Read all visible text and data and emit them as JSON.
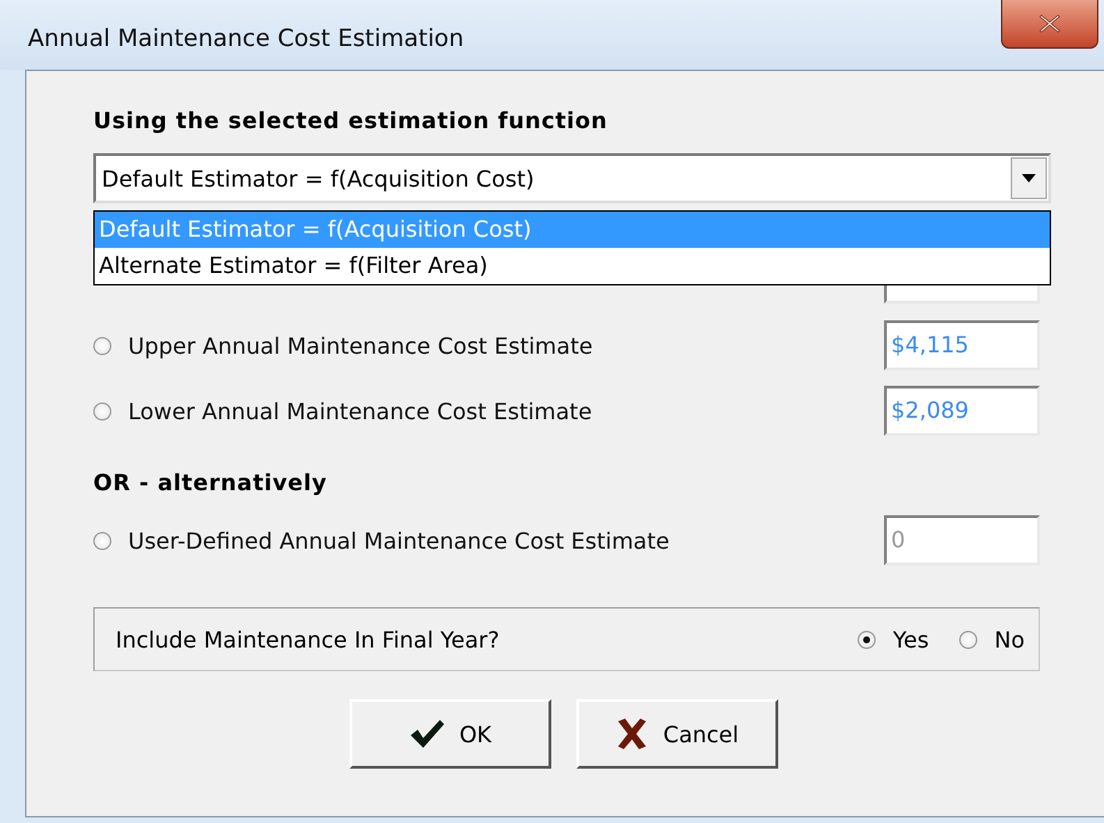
{
  "window": {
    "title": "Annual Maintenance Cost Estimation"
  },
  "heading": "Using the selected estimation function",
  "estimator": {
    "value": "Default Estimator = f(Acquisition Cost)",
    "expanded": true,
    "options": [
      {
        "label": "Default Estimator = f(Acquisition Cost)",
        "selected": true
      },
      {
        "label": "Alternate Estimator = f(Filter Area)",
        "selected": false
      }
    ]
  },
  "estimates": [
    {
      "label": "Upper Annual Maintenance Cost Estimate",
      "value": "$4,115",
      "selected": false
    },
    {
      "label": "Lower Annual Maintenance Cost Estimate",
      "value": "$2,089",
      "selected": false
    }
  ],
  "alternative_heading": "OR - alternatively",
  "user_defined": {
    "label": "User-Defined Annual Maintenance Cost Estimate",
    "value": "0",
    "disabled": true,
    "selected": false
  },
  "final_year": {
    "label": "Include Maintenance In Final Year?",
    "options": [
      {
        "label": "Yes",
        "selected": true
      },
      {
        "label": "No",
        "selected": false
      }
    ]
  },
  "buttons": [
    {
      "kind": "ok",
      "label": "OK"
    },
    {
      "kind": "cancel",
      "label": "Cancel"
    }
  ]
}
